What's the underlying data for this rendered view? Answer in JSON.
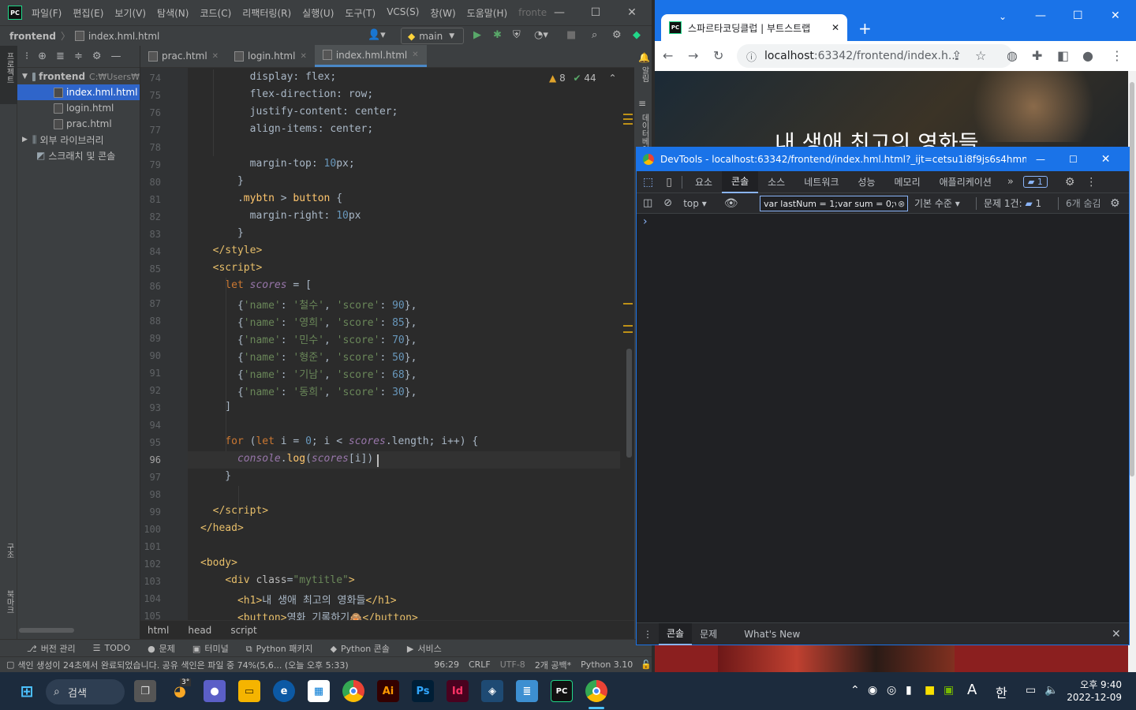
{
  "ide": {
    "menu": [
      "파일(F)",
      "편집(E)",
      "보기(V)",
      "탐색(N)",
      "코드(C)",
      "리팩터링(R)",
      "실행(U)",
      "도구(T)",
      "VCS(S)",
      "창(W)",
      "도움말(H)"
    ],
    "menu_dim": "fronte",
    "breadcrumb_project": "frontend",
    "breadcrumb_file": "index.hml.html",
    "branch": "main",
    "project_root": "frontend",
    "project_root_path": "C:₩Users₩",
    "files": [
      "index.hml.html",
      "login.html",
      "prac.html"
    ],
    "external_libs": "외부 라이브러리",
    "scratches": "스크래치 및 콘솔",
    "left_strip_project": "프로젝트",
    "left_strip_structure": "구조",
    "left_strip_bookmarks": "북마크",
    "right_strip_notifications": "알림",
    "right_strip_db": "데이터베이스",
    "tabs": [
      {
        "label": "prac.html"
      },
      {
        "label": "login.html"
      },
      {
        "label": "index.hml.html"
      }
    ],
    "inspection": {
      "warnings": "8",
      "weak": "44"
    },
    "code_lines": [
      {
        "n": "74",
        "html": "        display: <span class=\"cval\">flex</span>;"
      },
      {
        "n": "75",
        "html": "        flex-direction: row;"
      },
      {
        "n": "76",
        "html": "        justify-content: center;"
      },
      {
        "n": "77",
        "html": "        align-items: center;"
      },
      {
        "n": "78",
        "html": ""
      },
      {
        "n": "79",
        "html": "        margin-top: <span class=\"num\">10</span>px;"
      },
      {
        "n": "80",
        "html": "      }"
      },
      {
        "n": "81",
        "html": "      .<span class=\"fn\">mybtn</span> &gt; <span class=\"fn\">button</span> {"
      },
      {
        "n": "82",
        "html": "        margin-right: <span class=\"num\">10</span>px"
      },
      {
        "n": "83",
        "html": "      }"
      },
      {
        "n": "84",
        "html": "  <span class=\"tag\">&lt;/style&gt;</span>"
      },
      {
        "n": "85",
        "html": "  <span class=\"tag\">&lt;script&gt;</span>"
      },
      {
        "n": "86",
        "html": "    <span class=\"kw\">let</span> <span class=\"var\">scores</span> = ["
      },
      {
        "n": "87",
        "html": "      {<span class=\"str\">'name'</span>: <span class=\"str\">'철수'</span>, <span class=\"str\">'score'</span>: <span class=\"num\">90</span>},"
      },
      {
        "n": "88",
        "html": "      {<span class=\"str\">'name'</span>: <span class=\"str\">'영희'</span>, <span class=\"str\">'score'</span>: <span class=\"num\">85</span>},"
      },
      {
        "n": "89",
        "html": "      {<span class=\"str\">'name'</span>: <span class=\"str\">'민수'</span>, <span class=\"str\">'score'</span>: <span class=\"num\">70</span>},"
      },
      {
        "n": "90",
        "html": "      {<span class=\"str\">'name'</span>: <span class=\"str\">'형준'</span>, <span class=\"str\">'score'</span>: <span class=\"num\">50</span>},"
      },
      {
        "n": "91",
        "html": "      {<span class=\"str\">'name'</span>: <span class=\"str\">'기남'</span>, <span class=\"str\">'score'</span>: <span class=\"num\">68</span>},"
      },
      {
        "n": "92",
        "html": "      {<span class=\"str\">'name'</span>: <span class=\"str\">'동희'</span>, <span class=\"str\">'score'</span>: <span class=\"num\">30</span>},"
      },
      {
        "n": "93",
        "html": "    ]"
      },
      {
        "n": "94",
        "html": ""
      },
      {
        "n": "95",
        "html": "    <span class=\"kw\">for</span> (<span class=\"kw\">let</span> i = <span class=\"num\">0</span>; i &lt; <span class=\"var\">scores</span>.length; i++) {"
      },
      {
        "n": "96",
        "html": "      <span class=\"var\">console</span>.<span class=\"fn\">log</span>(<span class=\"var\">scores</span>[i])"
      },
      {
        "n": "97",
        "html": "    }"
      },
      {
        "n": "98",
        "html": ""
      },
      {
        "n": "99",
        "html": "  <span class=\"tag\">&lt;/script&gt;</span>"
      },
      {
        "n": "100",
        "html": "<span class=\"tag\">&lt;/head&gt;</span>"
      },
      {
        "n": "101",
        "html": ""
      },
      {
        "n": "102",
        "html": "<span class=\"tag\">&lt;body&gt;</span>"
      },
      {
        "n": "103",
        "html": "    <span class=\"tag\">&lt;div </span><span class=\"attr\">class</span>=<span class=\"str\">\"mytitle\"</span><span class=\"tag\">&gt;</span>"
      },
      {
        "n": "104",
        "html": "      <span class=\"tag\">&lt;h1&gt;</span>내 생애 최고의 영화들<span class=\"tag\">&lt;/h1&gt;</span>"
      },
      {
        "n": "105",
        "html": "      <span class=\"tag\">&lt;button&gt;</span>영화 기록하기🙈<span class=\"tag\">&lt;/button&gt;</span>"
      }
    ],
    "current_line": "96",
    "path_crumbs": [
      "html",
      "head",
      "script"
    ],
    "tool_windows": [
      "버전 관리",
      "TODO",
      "문제",
      "터미널",
      "Python 패키지",
      "Python 콘솔",
      "서비스"
    ],
    "status": {
      "message": "색인 생성이 24초에서 완료되었습니다. 공유 색인은 파일 중 74%(5,6... (오늘 오후 5:33)",
      "position": "96:29",
      "line_sep": "CRLF",
      "encoding": "UTF-8",
      "indent": "2개 공백*",
      "interpreter": "Python 3.10"
    }
  },
  "browser": {
    "tab_title": "스파르타코딩클럽 | 부트스트랩",
    "url_host": "localhost",
    "url_rest": ":63342/frontend/index.h...",
    "page_heading": "내 생애 최고의 영화들"
  },
  "devtools": {
    "title": "DevTools - localhost:63342/frontend/index.hml.html?_ijt=cetsu1i8f9js6s4hmmc7cdu...",
    "tabs": [
      "요소",
      "콘솔",
      "소스",
      "네트워크",
      "성능",
      "메모리",
      "애플리케이션"
    ],
    "issues_badge": "1",
    "context": "top",
    "filter_value": "var lastNum = 1;var sum = 0;va",
    "level": "기본 수준",
    "issues_label": "문제 1건:",
    "issues_count": "1",
    "hidden": "6개 숨김",
    "prompt": "›",
    "drawer_tabs": [
      "콘솔",
      "문제",
      "What's New"
    ]
  },
  "taskbar": {
    "search": "검색",
    "weather": "3°",
    "apps": [
      {
        "label": "Ai",
        "color": "#330000",
        "fg": "#ff9a00"
      },
      {
        "label": "Ps",
        "color": "#001e36",
        "fg": "#31a8ff"
      },
      {
        "label": "Id",
        "color": "#49021f",
        "fg": "#ff3366"
      }
    ],
    "ime_a": "A",
    "ime_han": "한",
    "time": "오후 9:40",
    "date": "2022-12-09"
  }
}
